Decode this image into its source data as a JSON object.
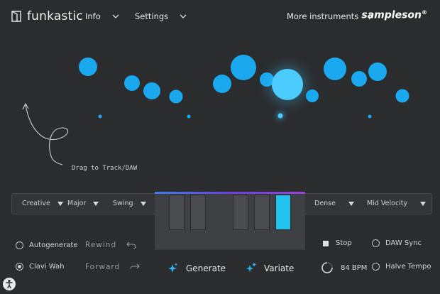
{
  "app": {
    "name": "funkastic",
    "brand": "sampleson",
    "brand_mark": "®"
  },
  "menu": {
    "info": "Info",
    "settings": "Settings",
    "more_instruments": "More instruments"
  },
  "canvas": {
    "drag_label": "Drag to Track/DAW"
  },
  "controls": {
    "creative": "Creative",
    "major": "Major",
    "swing": "Swing",
    "dense": "Dense",
    "mid_velocity": "Mid Velocity"
  },
  "bottom": {
    "autogenerate": "Autogenerate",
    "rewind": "Rewind",
    "clavi_wah": "Clavi Wah",
    "forward": "Forward",
    "generate": "Generate",
    "variate": "Variate",
    "stop": "Stop",
    "daw_sync": "DAW Sync",
    "bpm": "84 BPM",
    "halve_tempo": "Halve Tempo"
  },
  "state": {
    "autogenerate_selected": false,
    "clavi_wah_selected": true,
    "daw_sync_selected": false,
    "halve_tempo_selected": false,
    "active_black_key": 5
  },
  "colors": {
    "accent": "#1aa8ef",
    "active_key": "#22c3ee",
    "background": "#2b2c2e"
  }
}
